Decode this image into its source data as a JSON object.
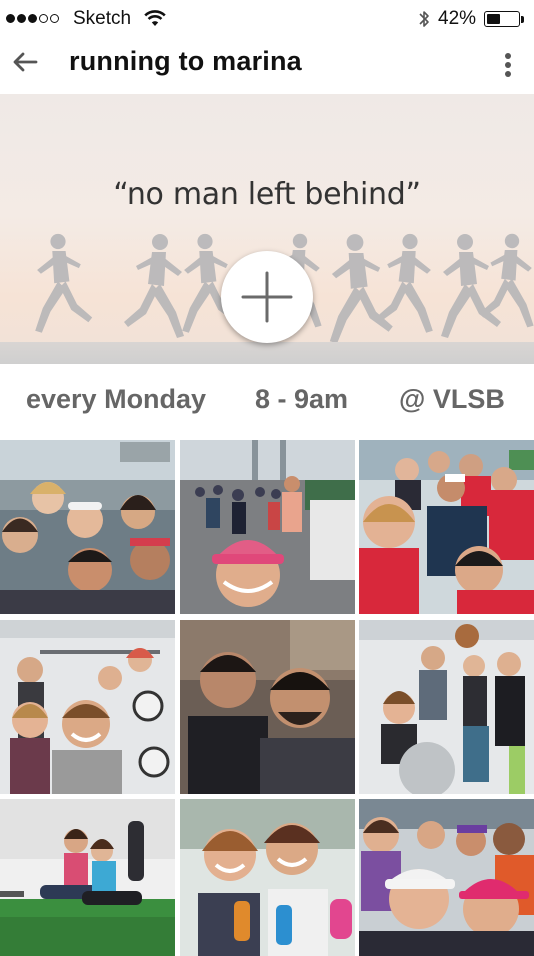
{
  "status_bar": {
    "signal_dots_filled": 3,
    "signal_dots_total": 5,
    "carrier": "Sketch",
    "wifi_icon": "wifi-icon",
    "bluetooth_icon": "bluetooth-icon",
    "battery_percent": "42%",
    "battery_level": 0.42
  },
  "header": {
    "back_icon": "arrow-left-icon",
    "title": "running to marina",
    "menu_icon": "more-vertical-icon"
  },
  "hero": {
    "quote": "“no man left behind”",
    "add_icon": "plus-icon"
  },
  "schedule": {
    "day": "every Monday",
    "time": "8 - 9am",
    "location": "@ VLSB"
  },
  "photos": [
    {
      "name": "group-selfie-waterfront"
    },
    {
      "name": "race-selfie-bridge"
    },
    {
      "name": "group-selfie-red-shirts"
    },
    {
      "name": "gym-class-group"
    },
    {
      "name": "two-men-selfie"
    },
    {
      "name": "gym-fitness-group"
    },
    {
      "name": "two-women-sitting-gym"
    },
    {
      "name": "two-women-water-bottles"
    },
    {
      "name": "group-selfie-visors"
    }
  ],
  "colors": {
    "title": "#111111",
    "schedule_text": "#666666",
    "hero_bg": "#f4ebe5",
    "runner_silhouette": "#b3b3b6"
  }
}
